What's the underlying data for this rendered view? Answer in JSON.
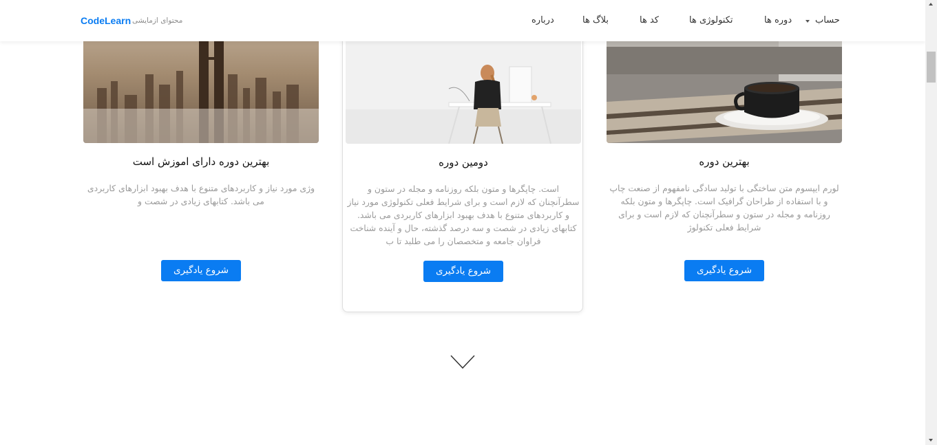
{
  "navbar": {
    "brand": "CodeLearn",
    "brand_subtitle": "محتوای ازمایشی",
    "items": [
      {
        "label": "حساب"
      },
      {
        "label": "دوره ها"
      },
      {
        "label": "تکنولوژی ها"
      },
      {
        "label": "کد ها"
      },
      {
        "label": "بلاگ ها"
      },
      {
        "label": "درباره"
      }
    ]
  },
  "cards": [
    {
      "title": "بهترین دوره دارای اموزش است",
      "description": "وژی مورد نیاز و کاربردهای متنوع با هدف بهبود ابزارهای کاربردی می باشد. کتابهای زیادی در شصت و",
      "button": "شروع یادگیری",
      "image": "city-skyline-in-fog"
    },
    {
      "title": "دومین دوره",
      "description": "است. چاپگرها و متون بلکه روزنامه و مجله در ستون و سطرآنچنان که لازم است و برای شرایط فعلی تکنولوژی مورد نیاز و کاربردهای متنوع با هدف بهبود ابزارهای کاربردی می باشد. کتابهای زیادی در شصت و سه درصد گذشته، حال و آینده شناخت فراوان جامعه و متخصصان را می طلبد تا ب",
      "button": "شروع یادگیری",
      "image": "woman-at-desk"
    },
    {
      "title": "بهترین دوره",
      "description": "لورم ایپسوم متن ساختگی با تولید سادگی نامفهوم از صنعت چاپ و با استفاده از طراحان گرافیک است. چاپگرها و متون بلکه روزنامه و مجله در ستون و سطرآنچنان که لازم است و برای شرایط فعلی تکنولوژ",
      "button": "شروع یادگیری",
      "image": "coffee-cup-on-table"
    }
  ],
  "colors": {
    "brand": "#0a7cf2",
    "button": "#0a7cf2",
    "muted_text": "#9a9a9a"
  },
  "icons": {
    "scroll_hint": "chevron-down-icon",
    "dropdown": "caret-down-icon"
  }
}
